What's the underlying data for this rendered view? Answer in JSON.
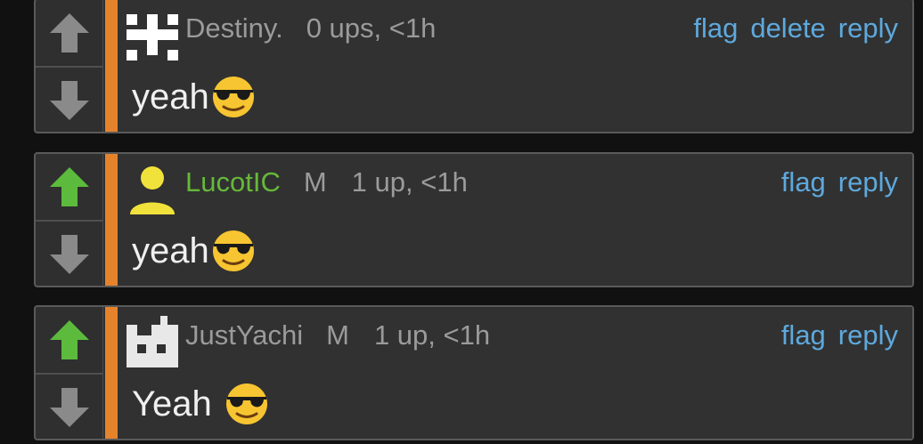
{
  "comments": [
    {
      "username": "Destiny.",
      "name_color": "#9b9b9b",
      "gender": "",
      "score": "0 ups, <1h",
      "actions": [
        "flag",
        "delete",
        "reply"
      ],
      "text": "yeah",
      "emoji_icon": "sunglasses-emoji-icon",
      "upvoted": false
    },
    {
      "username": "LucotIC",
      "name_color": "#66b83a",
      "gender": "M",
      "score": "1 up, <1h",
      "actions": [
        "flag",
        "reply"
      ],
      "text": "yeah",
      "emoji_icon": "sunglasses-emoji-icon",
      "upvoted": true
    },
    {
      "username": "JustYachi",
      "name_color": "#9b9b9b",
      "gender": "M",
      "score": "1 up, <1h",
      "actions": [
        "flag",
        "reply"
      ],
      "text": "Yeah",
      "emoji_icon": "sunglasses-emoji-icon",
      "upvoted": true
    }
  ],
  "colors": {
    "accent": "#e5832c",
    "link": "#5ea9dd",
    "upvote_active": "#5cbb3c",
    "vote_inactive": "#8a8a8a"
  }
}
